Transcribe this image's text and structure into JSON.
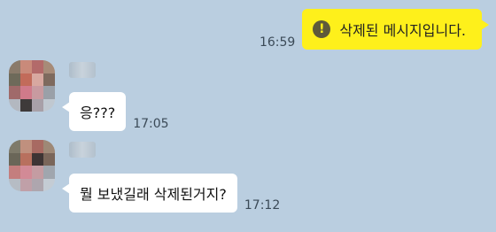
{
  "colors": {
    "background": "#bacee0",
    "outgoing_bubble": "#fef01b",
    "incoming_bubble": "#ffffff",
    "timestamp_text": "#3b4a57"
  },
  "messages": [
    {
      "direction": "outgoing",
      "icon": "warning-exclamation-icon",
      "icon_glyph": "!",
      "text": "삭제된 메시지입니다.",
      "time": "16:59"
    },
    {
      "direction": "incoming",
      "text": "응???",
      "time": "17:05"
    },
    {
      "direction": "incoming",
      "text": "뭘 보냈길래 삭제된거지?",
      "time": "17:12"
    }
  ]
}
